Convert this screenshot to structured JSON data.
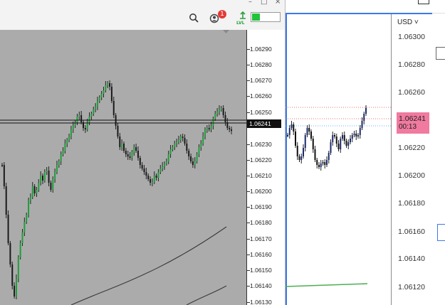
{
  "left_window": {
    "controls": {
      "minimize": "–",
      "restore": "□",
      "close": "×"
    },
    "toolbar": {
      "icons": [
        "search-icon",
        "notifications-icon",
        "signal-level-icon"
      ],
      "notification_count": "1",
      "level_label": "LVL",
      "level_fraction": 0.3,
      "colors": {
        "badge": "#e53935",
        "level_fill": "#21c33a"
      }
    },
    "chart": {
      "background": "#ababab",
      "price_axis_labels": [
        "1.06290",
        "1.06280",
        "1.06270",
        "1.06260",
        "1.06250",
        "1.06230",
        "1.06220",
        "1.06210",
        "1.06200",
        "1.06190",
        "1.06180",
        "1.06170",
        "1.06160",
        "1.06150",
        "1.06140",
        "1.06130"
      ],
      "current_price": "1.06241",
      "colors": {
        "bull": "#1f9e3a",
        "bear": "#1a1a1a",
        "wick": "#222222"
      }
    }
  },
  "right_panel": {
    "currency": "USD ˅",
    "price_axis_labels": [
      "1.06300",
      "1.06280",
      "1.06260",
      "1.06220",
      "1.06200",
      "1.06180",
      "1.06160",
      "1.06140",
      "1.06120"
    ],
    "current_price": "1.06241",
    "countdown": "00:13",
    "colors": {
      "frame": "#3b78e7",
      "price_tag": "#f07aa0",
      "indicator_line": "#4caf50",
      "bull": "#1a2a6c",
      "bear": "#111111"
    }
  }
}
